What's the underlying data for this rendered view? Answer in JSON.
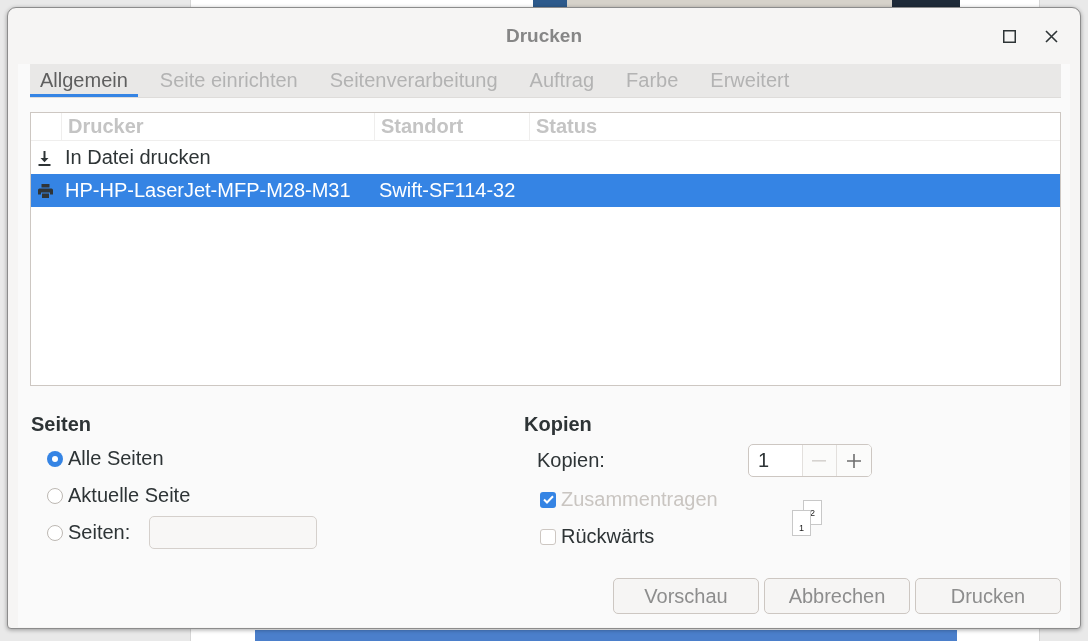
{
  "window": {
    "title": "Drucken"
  },
  "tabs": [
    {
      "label": "Allgemein",
      "selected": true
    },
    {
      "label": "Seite einrichten",
      "selected": false
    },
    {
      "label": "Seitenverarbeitung",
      "selected": false
    },
    {
      "label": "Auftrag",
      "selected": false
    },
    {
      "label": "Farbe",
      "selected": false
    },
    {
      "label": "Erweitert",
      "selected": false
    }
  ],
  "printers": {
    "columns": [
      "Drucker",
      "Standort",
      "Status"
    ],
    "rows": [
      {
        "kind": "file",
        "name": "In Datei drucken",
        "selected": false
      },
      {
        "kind": "printer",
        "name": "HP-HP-LaserJet-MFP-M28-M31",
        "location": "Swift-SF114-32",
        "selected": true
      }
    ]
  },
  "pages": {
    "heading": "Seiten",
    "options": [
      {
        "kind": "plain",
        "label": "Alle Seiten",
        "selected": true
      },
      {
        "kind": "plain",
        "label": "Aktuelle Seite",
        "selected": false
      },
      {
        "kind": "range",
        "label": "Seiten:",
        "selected": false
      }
    ]
  },
  "copies": {
    "heading": "Kopien",
    "label": "Kopien:",
    "value": "1",
    "decrement_disabled": true,
    "options": [
      {
        "label": "Zusammentragen",
        "checked": true,
        "disabled": true
      },
      {
        "label": "Rückwärts",
        "checked": false,
        "disabled": false
      }
    ],
    "collate_preview": [
      "1",
      "2"
    ]
  },
  "buttons": [
    "Vorschau",
    "Abbrechen",
    "Drucken"
  ]
}
